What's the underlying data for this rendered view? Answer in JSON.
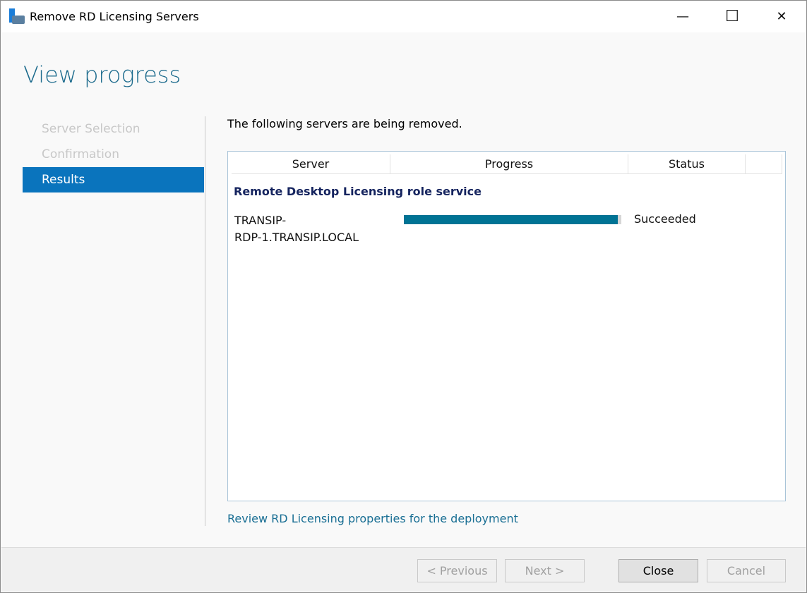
{
  "window": {
    "title": "Remove RD Licensing Servers",
    "minimize": "—",
    "maximize": "☐",
    "close": "✕"
  },
  "heading": "View progress",
  "nav": [
    {
      "label": "Server Selection",
      "active": false
    },
    {
      "label": "Confirmation",
      "active": false
    },
    {
      "label": "Results",
      "active": true
    }
  ],
  "intro": "The following servers are being removed.",
  "table": {
    "columns": [
      "Server",
      "Progress",
      "Status"
    ],
    "group": "Remote Desktop Licensing role service",
    "rows": [
      {
        "server_line1": "TRANSIP-",
        "server_line2": "RDP-1.TRANSIP.LOCAL",
        "progress_percent": 100,
        "status": "Succeeded"
      }
    ]
  },
  "link": "Review RD Licensing properties for the deployment",
  "buttons": {
    "previous": "< Previous",
    "next": "Next >",
    "close": "Close",
    "cancel": "Cancel"
  },
  "colors": {
    "accent": "#0a74bd",
    "progress": "#007394",
    "heading": "#1b6a8c"
  }
}
